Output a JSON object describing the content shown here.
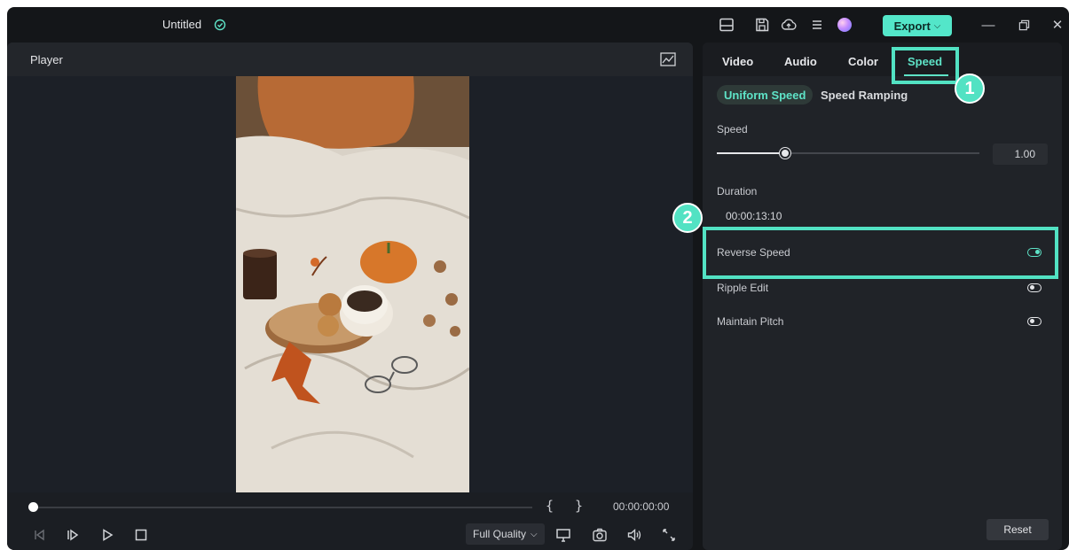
{
  "app": {
    "title": "Untitled",
    "export_label": "Export",
    "accent": "#53e6c9",
    "window_controls": [
      "minimize-icon",
      "restore-icon",
      "close-icon"
    ]
  },
  "toolbar": {
    "icons": [
      "layout-icon",
      "save-icon",
      "cloud-upload-icon",
      "menu-icon",
      "avatar"
    ]
  },
  "player": {
    "title": "Player",
    "timecode": "00:00:00:00",
    "in_mark": "{",
    "out_mark": "}",
    "quality": "Full Quality",
    "progress": 0,
    "controls": [
      "previous-frame-icon",
      "next-frame-icon",
      "play-icon",
      "stop-icon",
      "display-icon",
      "snapshot-icon",
      "volume-icon",
      "fullscreen-icon"
    ]
  },
  "panel": {
    "tabs": [
      {
        "label": "Video"
      },
      {
        "label": "Audio"
      },
      {
        "label": "Color"
      },
      {
        "label": "Speed",
        "active": true
      }
    ],
    "modes": [
      {
        "label": "Uniform Speed",
        "active": true
      },
      {
        "label": "Speed Ramping"
      }
    ],
    "speed": {
      "label": "Speed",
      "value": "1.00",
      "slider_fraction": 0.26
    },
    "duration": {
      "label": "Duration",
      "value": "00:00:13:10"
    },
    "options": [
      {
        "label": "Reverse Speed",
        "on": true
      },
      {
        "label": "Ripple Edit",
        "on": false
      },
      {
        "label": "Maintain Pitch",
        "on": false
      }
    ],
    "reset_label": "Reset"
  },
  "annotations": [
    {
      "number": "1"
    },
    {
      "number": "2"
    }
  ]
}
